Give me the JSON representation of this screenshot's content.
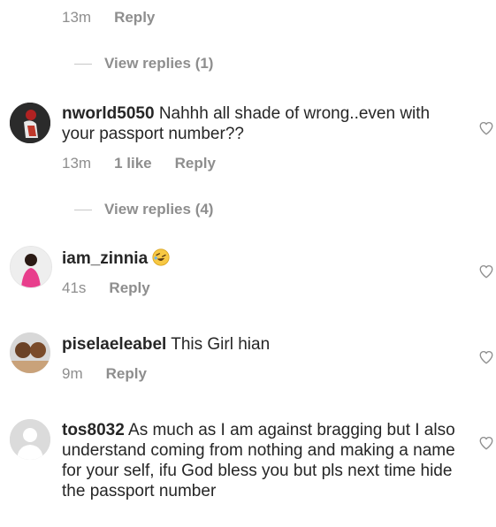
{
  "top_meta": {
    "time": "13m",
    "reply": "Reply"
  },
  "view_replies_1": "View replies (1)",
  "comments": [
    {
      "username": "nworld5050",
      "text": "Nahhh all shade of wrong..even with your passport number??",
      "time": "13m",
      "likes": "1 like",
      "reply": "Reply"
    },
    {
      "username": "iam_zinnia",
      "text": "",
      "emoji": "rolling-on-floor-laughing-emoji",
      "time": "41s",
      "reply": "Reply"
    },
    {
      "username": "piselaeleabel",
      "text": "This Girl hian",
      "time": "9m",
      "reply": "Reply"
    },
    {
      "username": "tos8032",
      "text": "As much as I am against bragging but I also understand coming from nothing and making a name for your self, ifu God bless you but pls next time hide the passport number"
    }
  ],
  "view_replies_2": "View replies (4)",
  "colors": {
    "text": "#262626",
    "muted": "#8e8e8e",
    "divider": "#c7c7c7"
  }
}
